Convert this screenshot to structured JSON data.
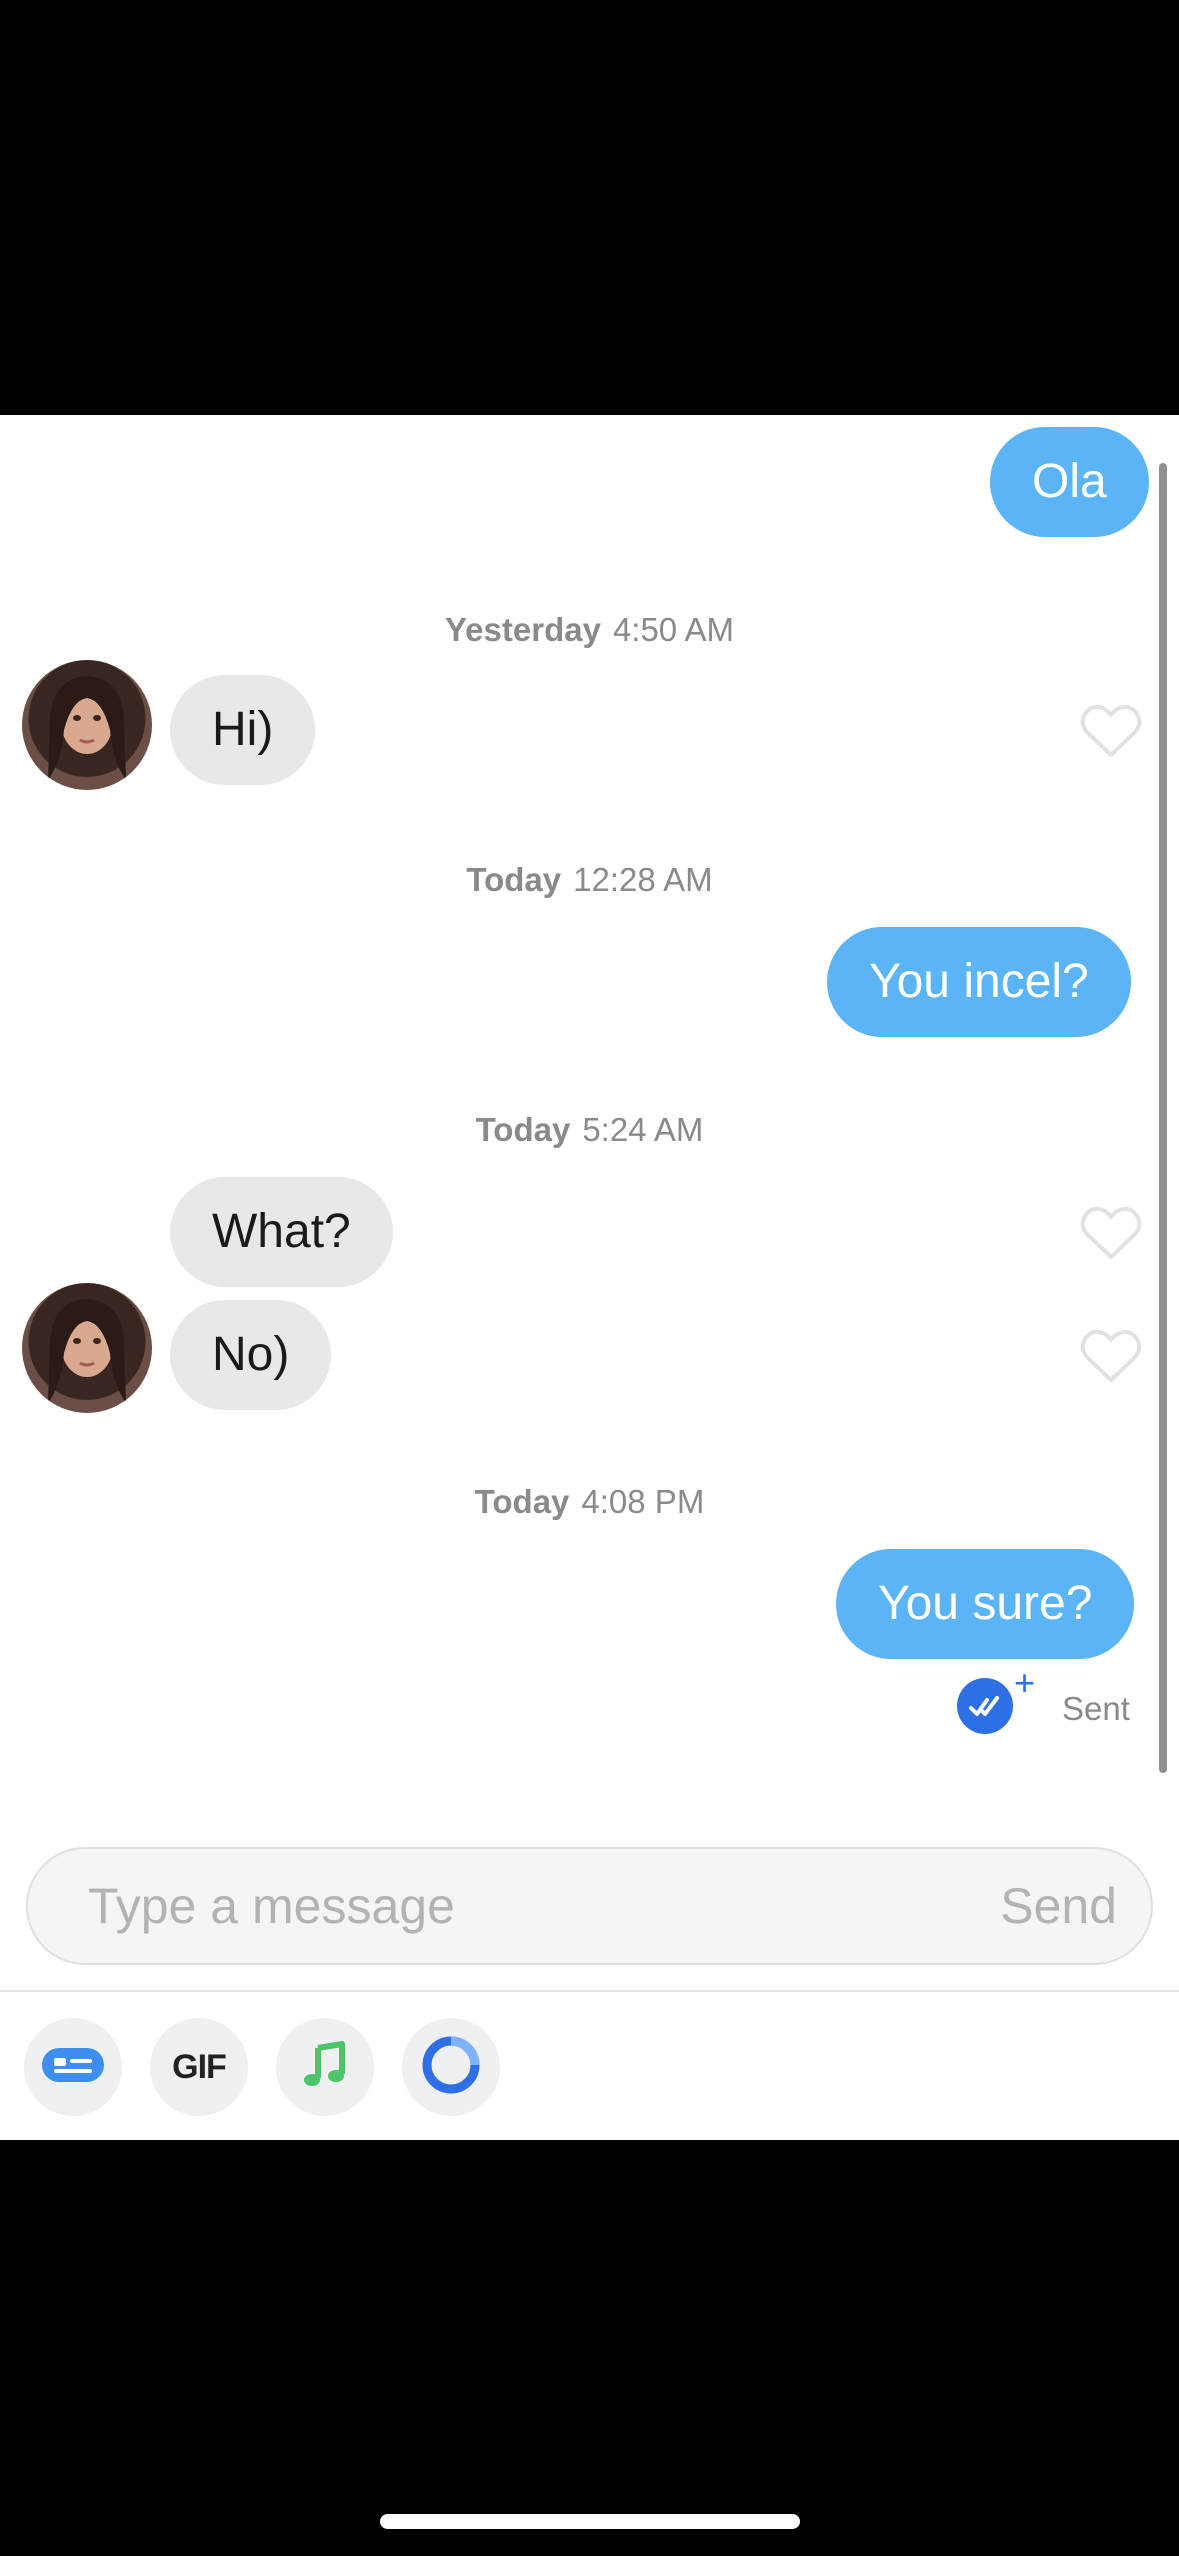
{
  "conversation": {
    "messages": [
      {
        "id": "m1",
        "direction": "outgoing",
        "text": "Ola"
      },
      {
        "id": "m2",
        "direction": "incoming",
        "text": "Hi)"
      },
      {
        "id": "m3",
        "direction": "outgoing",
        "text": "You incel?"
      },
      {
        "id": "m4",
        "direction": "incoming",
        "text": "What?"
      },
      {
        "id": "m5",
        "direction": "incoming",
        "text": "No)"
      },
      {
        "id": "m6",
        "direction": "outgoing",
        "text": "You sure?"
      }
    ],
    "timestamps": [
      {
        "day": "Yesterday",
        "time": "4:50 AM"
      },
      {
        "day": "Today",
        "time": "12:28 AM"
      },
      {
        "day": "Today",
        "time": "5:24 AM"
      },
      {
        "day": "Today",
        "time": "4:08 PM"
      }
    ],
    "status": "Sent"
  },
  "composer": {
    "placeholder": "Type a message",
    "send_label": "Send"
  },
  "toolbar": {
    "gif_label": "GIF"
  },
  "colors": {
    "outgoing_bubble": "#5ab4f6",
    "incoming_bubble": "#e8e8e8",
    "receipt_blue": "#2e6fe6",
    "music_green": "#4cc46a"
  },
  "icons": [
    "heart-icon",
    "read-receipt-icon",
    "sticker-icon",
    "gif-icon",
    "music-icon",
    "loop-icon"
  ]
}
